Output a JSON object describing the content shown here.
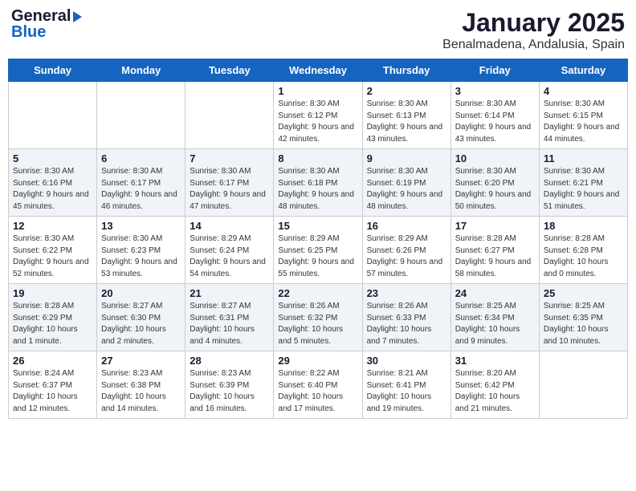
{
  "logo": {
    "general": "General",
    "blue": "Blue"
  },
  "title": "January 2025",
  "subtitle": "Benalmadena, Andalusia, Spain",
  "weekdays": [
    "Sunday",
    "Monday",
    "Tuesday",
    "Wednesday",
    "Thursday",
    "Friday",
    "Saturday"
  ],
  "weeks": [
    [
      {
        "day": "",
        "info": ""
      },
      {
        "day": "",
        "info": ""
      },
      {
        "day": "",
        "info": ""
      },
      {
        "day": "1",
        "info": "Sunrise: 8:30 AM\nSunset: 6:12 PM\nDaylight: 9 hours\nand 42 minutes."
      },
      {
        "day": "2",
        "info": "Sunrise: 8:30 AM\nSunset: 6:13 PM\nDaylight: 9 hours\nand 43 minutes."
      },
      {
        "day": "3",
        "info": "Sunrise: 8:30 AM\nSunset: 6:14 PM\nDaylight: 9 hours\nand 43 minutes."
      },
      {
        "day": "4",
        "info": "Sunrise: 8:30 AM\nSunset: 6:15 PM\nDaylight: 9 hours\nand 44 minutes."
      }
    ],
    [
      {
        "day": "5",
        "info": "Sunrise: 8:30 AM\nSunset: 6:16 PM\nDaylight: 9 hours\nand 45 minutes."
      },
      {
        "day": "6",
        "info": "Sunrise: 8:30 AM\nSunset: 6:17 PM\nDaylight: 9 hours\nand 46 minutes."
      },
      {
        "day": "7",
        "info": "Sunrise: 8:30 AM\nSunset: 6:17 PM\nDaylight: 9 hours\nand 47 minutes."
      },
      {
        "day": "8",
        "info": "Sunrise: 8:30 AM\nSunset: 6:18 PM\nDaylight: 9 hours\nand 48 minutes."
      },
      {
        "day": "9",
        "info": "Sunrise: 8:30 AM\nSunset: 6:19 PM\nDaylight: 9 hours\nand 48 minutes."
      },
      {
        "day": "10",
        "info": "Sunrise: 8:30 AM\nSunset: 6:20 PM\nDaylight: 9 hours\nand 50 minutes."
      },
      {
        "day": "11",
        "info": "Sunrise: 8:30 AM\nSunset: 6:21 PM\nDaylight: 9 hours\nand 51 minutes."
      }
    ],
    [
      {
        "day": "12",
        "info": "Sunrise: 8:30 AM\nSunset: 6:22 PM\nDaylight: 9 hours\nand 52 minutes."
      },
      {
        "day": "13",
        "info": "Sunrise: 8:30 AM\nSunset: 6:23 PM\nDaylight: 9 hours\nand 53 minutes."
      },
      {
        "day": "14",
        "info": "Sunrise: 8:29 AM\nSunset: 6:24 PM\nDaylight: 9 hours\nand 54 minutes."
      },
      {
        "day": "15",
        "info": "Sunrise: 8:29 AM\nSunset: 6:25 PM\nDaylight: 9 hours\nand 55 minutes."
      },
      {
        "day": "16",
        "info": "Sunrise: 8:29 AM\nSunset: 6:26 PM\nDaylight: 9 hours\nand 57 minutes."
      },
      {
        "day": "17",
        "info": "Sunrise: 8:28 AM\nSunset: 6:27 PM\nDaylight: 9 hours\nand 58 minutes."
      },
      {
        "day": "18",
        "info": "Sunrise: 8:28 AM\nSunset: 6:28 PM\nDaylight: 10 hours\nand 0 minutes."
      }
    ],
    [
      {
        "day": "19",
        "info": "Sunrise: 8:28 AM\nSunset: 6:29 PM\nDaylight: 10 hours\nand 1 minute."
      },
      {
        "day": "20",
        "info": "Sunrise: 8:27 AM\nSunset: 6:30 PM\nDaylight: 10 hours\nand 2 minutes."
      },
      {
        "day": "21",
        "info": "Sunrise: 8:27 AM\nSunset: 6:31 PM\nDaylight: 10 hours\nand 4 minutes."
      },
      {
        "day": "22",
        "info": "Sunrise: 8:26 AM\nSunset: 6:32 PM\nDaylight: 10 hours\nand 5 minutes."
      },
      {
        "day": "23",
        "info": "Sunrise: 8:26 AM\nSunset: 6:33 PM\nDaylight: 10 hours\nand 7 minutes."
      },
      {
        "day": "24",
        "info": "Sunrise: 8:25 AM\nSunset: 6:34 PM\nDaylight: 10 hours\nand 9 minutes."
      },
      {
        "day": "25",
        "info": "Sunrise: 8:25 AM\nSunset: 6:35 PM\nDaylight: 10 hours\nand 10 minutes."
      }
    ],
    [
      {
        "day": "26",
        "info": "Sunrise: 8:24 AM\nSunset: 6:37 PM\nDaylight: 10 hours\nand 12 minutes."
      },
      {
        "day": "27",
        "info": "Sunrise: 8:23 AM\nSunset: 6:38 PM\nDaylight: 10 hours\nand 14 minutes."
      },
      {
        "day": "28",
        "info": "Sunrise: 8:23 AM\nSunset: 6:39 PM\nDaylight: 10 hours\nand 16 minutes."
      },
      {
        "day": "29",
        "info": "Sunrise: 8:22 AM\nSunset: 6:40 PM\nDaylight: 10 hours\nand 17 minutes."
      },
      {
        "day": "30",
        "info": "Sunrise: 8:21 AM\nSunset: 6:41 PM\nDaylight: 10 hours\nand 19 minutes."
      },
      {
        "day": "31",
        "info": "Sunrise: 8:20 AM\nSunset: 6:42 PM\nDaylight: 10 hours\nand 21 minutes."
      },
      {
        "day": "",
        "info": ""
      }
    ]
  ]
}
